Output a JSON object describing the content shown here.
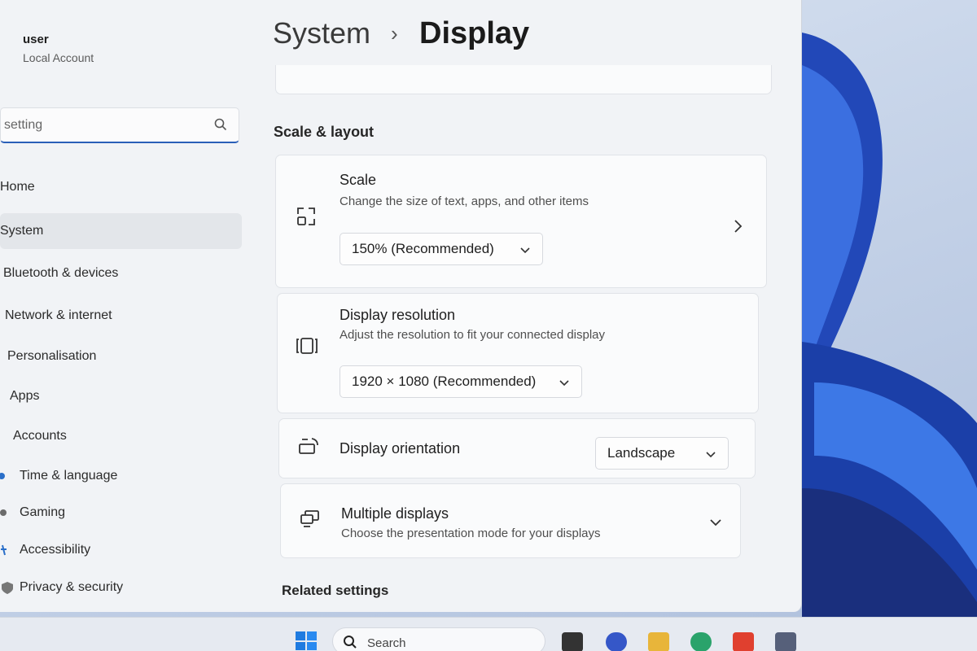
{
  "user": {
    "name": "user",
    "account_type": "Local Account"
  },
  "search": {
    "value": "setting"
  },
  "sidebar": {
    "items": [
      {
        "label": "Home",
        "icon": "home-icon"
      },
      {
        "label": "System",
        "icon": "system-icon",
        "selected": true
      },
      {
        "label": "Bluetooth & devices",
        "icon": "bluetooth-icon"
      },
      {
        "label": "Network & internet",
        "icon": "network-icon"
      },
      {
        "label": "Personalisation",
        "icon": "brush-icon"
      },
      {
        "label": "Apps",
        "icon": "apps-icon"
      },
      {
        "label": "Accounts",
        "icon": "accounts-icon"
      },
      {
        "label": "Time & language",
        "icon": "globe-icon"
      },
      {
        "label": "Gaming",
        "icon": "gamepad-icon"
      },
      {
        "label": "Accessibility",
        "icon": "accessibility-icon"
      },
      {
        "label": "Privacy & security",
        "icon": "shield-icon"
      }
    ]
  },
  "breadcrumb": {
    "parent": "System",
    "separator": "›",
    "current": "Display"
  },
  "scale_layout": {
    "heading": "Scale & layout",
    "scale": {
      "title": "Scale",
      "description": "Change the size of text, apps, and other items",
      "value": "150% (Recommended)",
      "icon": "scale-icon"
    },
    "resolution": {
      "title": "Display resolution",
      "description": "Adjust the resolution to fit your connected display",
      "value": "1920 × 1080 (Recommended)",
      "icon": "resolution-icon"
    },
    "orientation": {
      "title": "Display orientation",
      "value": "Landscape",
      "icon": "orientation-icon"
    },
    "multiple_displays": {
      "title": "Multiple displays",
      "description": "Choose the presentation mode for your displays",
      "icon": "multiple-displays-icon"
    }
  },
  "related": {
    "heading": "Related settings"
  },
  "taskbar": {
    "search_label": "Search"
  },
  "colors": {
    "accent": "#2a5fb8",
    "card": "#fafbfc",
    "window": "#f1f3f6"
  }
}
